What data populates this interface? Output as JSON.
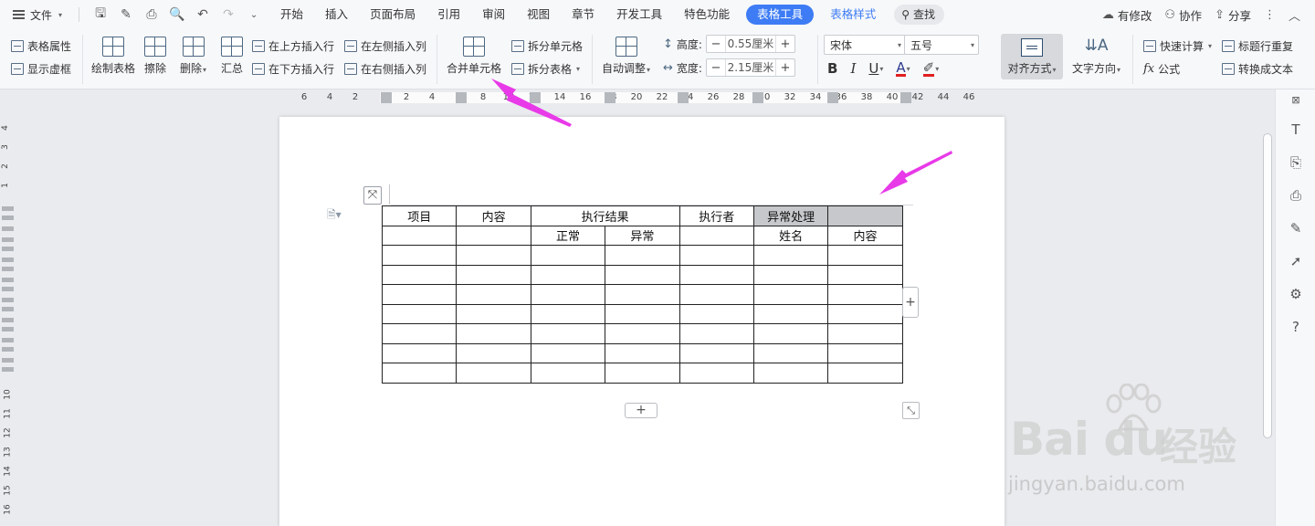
{
  "menubar": {
    "file_label": "文件",
    "tabs": [
      "开始",
      "插入",
      "页面布局",
      "引用",
      "审阅",
      "视图",
      "章节",
      "开发工具",
      "特色功能"
    ],
    "active_tab": "表格工具",
    "context_tab": "表格样式",
    "search_label": "查找",
    "right": {
      "modified": "有修改",
      "collab": "协作",
      "share": "分享"
    }
  },
  "ribbon": {
    "table_props": "表格属性",
    "show_gridlines": "显示虚框",
    "draw_table": "绘制表格",
    "erase": "擦除",
    "delete": "删除",
    "summary": "汇总",
    "insert_row_above": "在上方插入行",
    "insert_row_below": "在下方插入行",
    "insert_col_left": "在左侧插入列",
    "insert_col_right": "在右侧插入列",
    "merge_cells": "合并单元格",
    "split_cells": "拆分单元格",
    "split_table": "拆分表格",
    "auto_fit": "自动调整",
    "height_label": "高度:",
    "height_value": "0.55厘米",
    "width_label": "宽度:",
    "width_value": "2.15厘米",
    "font_name": "宋体",
    "font_size": "五号",
    "bold": "B",
    "italic": "I",
    "underline": "U",
    "font_color_glyph": "A",
    "align": "对齐方式",
    "text_direction": "文字方向",
    "quick_calc": "快速计算",
    "repeat_header": "标题行重复",
    "formula": "公式",
    "convert_text": "转换成文本",
    "colors": {
      "font_color": "#e02020",
      "highlight": "#e02020"
    }
  },
  "ruler": {
    "h_numbers": [
      "6",
      "4",
      "2",
      "2",
      "4",
      "8",
      "10",
      "12",
      "14",
      "16",
      "18",
      "20",
      "22",
      "24",
      "26",
      "28",
      "30",
      "32",
      "34",
      "36",
      "38",
      "40",
      "42",
      "44",
      "46"
    ],
    "v_numbers": [
      "4",
      "3",
      "2",
      "1",
      "10",
      "11",
      "12",
      "13",
      "14",
      "15",
      "16"
    ]
  },
  "table": {
    "rows": [
      [
        "项目",
        "内容",
        "执行结果",
        "",
        "执行者",
        "异常处理",
        ""
      ],
      [
        "",
        "",
        "正常",
        "异常",
        "",
        "姓名",
        "内容"
      ],
      [
        "",
        "",
        "",
        "",
        "",
        "",
        ""
      ],
      [
        "",
        "",
        "",
        "",
        "",
        "",
        ""
      ],
      [
        "",
        "",
        "",
        "",
        "",
        "",
        ""
      ],
      [
        "",
        "",
        "",
        "",
        "",
        "",
        ""
      ],
      [
        "",
        "",
        "",
        "",
        "",
        "",
        ""
      ],
      [
        "",
        "",
        "",
        "",
        "",
        "",
        ""
      ],
      [
        "",
        "",
        "",
        "",
        "",
        "",
        ""
      ]
    ],
    "selected_cells": [
      [
        0,
        5
      ],
      [
        0,
        6
      ]
    ],
    "selection_color": "#c6c8cb"
  },
  "annotation": {
    "arrow_color": "#e83ae8"
  },
  "watermark": {
    "logo": "Bai du",
    "cn": "经验",
    "url": "jingyan.baidu.com"
  }
}
